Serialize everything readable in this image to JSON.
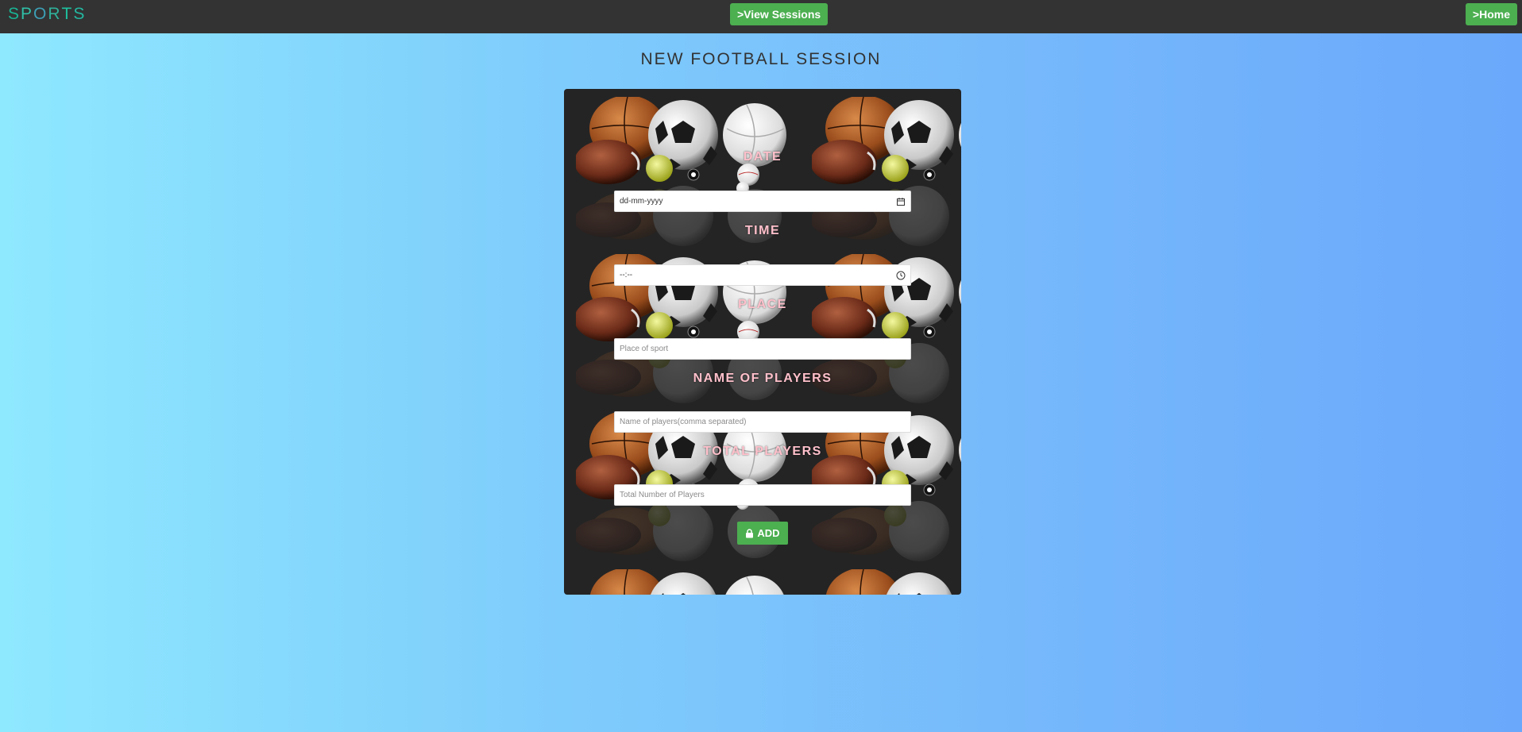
{
  "navbar": {
    "brand": "SPORTS",
    "brand_colors": [
      "#1ab394",
      "#2fc0a8",
      "#3d9fb5",
      "#2fb09a",
      "#1ec29f",
      "#24b7a0"
    ],
    "view_sessions_label": ">View Sessions",
    "home_label": ">Home",
    "button_color": "#4caf50"
  },
  "page": {
    "title": "NEW FOOTBALL SESSION"
  },
  "form": {
    "label_color": "#ffc0cb",
    "date": {
      "label": "DATE",
      "value": "dd-mm-yyyy",
      "icon": "calendar-icon"
    },
    "time": {
      "label": "TIME",
      "value": "--:--",
      "icon": "clock-icon"
    },
    "place": {
      "label": "PLACE",
      "placeholder": "Place of sport"
    },
    "players": {
      "label": "NAME OF PLAYERS",
      "placeholder": "Name of players(comma separated)"
    },
    "total": {
      "label": "TOTAL PLAYERS",
      "placeholder": "Total Number of Players"
    },
    "submit": {
      "label": "ADD",
      "icon": "lock-icon"
    }
  }
}
